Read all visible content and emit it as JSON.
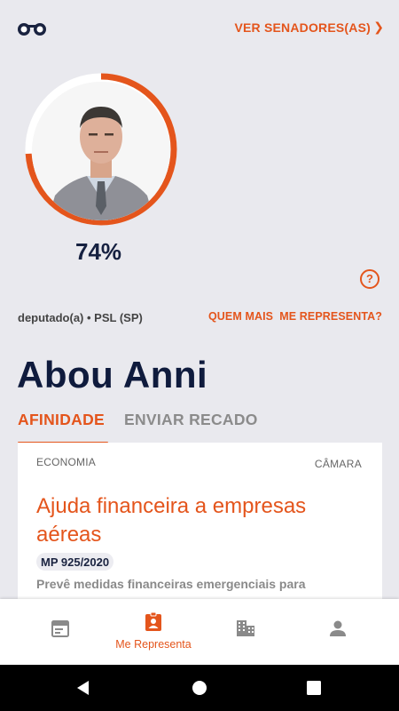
{
  "header": {
    "logo_icon": "glasses-icon",
    "ver_senadores_label": "VER SENADORES(AS)",
    "ver_senadores_chevron": "❯"
  },
  "profile": {
    "affinity_percent": "74%",
    "affinity_value": 0.74,
    "role": "deputado(a) • PSL (SP)",
    "name": "Abou Anni",
    "help_label": "?",
    "quem_mais_label": "QUEM MAIS  ME REPRESENTA?"
  },
  "tabs": [
    {
      "label": "AFINIDADE",
      "active": true
    },
    {
      "label": "ENVIAR RECADO",
      "active": false
    }
  ],
  "card": {
    "category": "ECONOMIA",
    "house": "CÂMARA",
    "title": "Ajuda financeira a empresas aéreas",
    "badge": "MP 925/2020",
    "description": "Prevê medidas financeiras emergenciais para"
  },
  "bottom_nav": {
    "items": [
      {
        "icon": "calendar-icon",
        "label": ""
      },
      {
        "icon": "id-badge-icon",
        "label": "Me Representa",
        "active": true
      },
      {
        "icon": "building-icon",
        "label": ""
      },
      {
        "icon": "person-icon",
        "label": ""
      }
    ]
  },
  "colors": {
    "accent": "#e4551c",
    "navy": "#0f1b3d",
    "background": "#e9e9ee"
  }
}
